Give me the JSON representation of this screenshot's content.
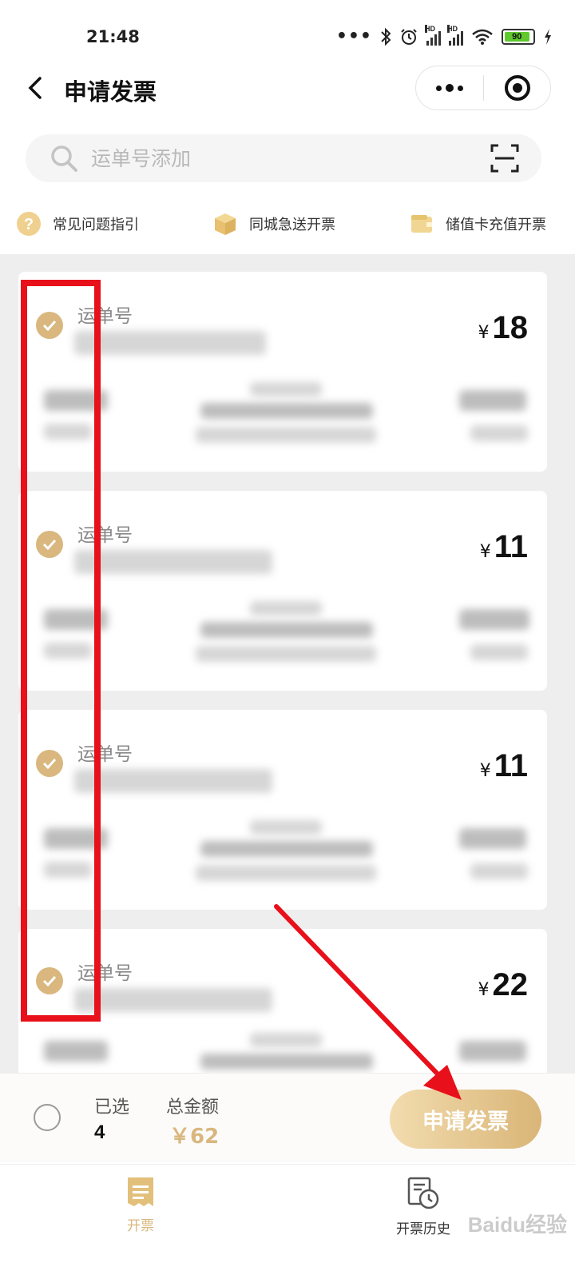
{
  "status_bar": {
    "time": "21:48",
    "dots": "•••",
    "hd1": "HD",
    "hd2": "HD",
    "battery": "90"
  },
  "header": {
    "title": "申请发票"
  },
  "search": {
    "placeholder": "运单号添加"
  },
  "quick_links": [
    {
      "label": "常见问题指引",
      "icon": "question-icon"
    },
    {
      "label": "同城急送开票",
      "icon": "box-icon"
    },
    {
      "label": "储值卡充值开票",
      "icon": "wallet-icon"
    }
  ],
  "orders": [
    {
      "label": "运单号",
      "currency": "¥",
      "amount": "18",
      "checked": true
    },
    {
      "label": "运单号",
      "currency": "¥",
      "amount": "11",
      "checked": true
    },
    {
      "label": "运单号",
      "currency": "¥",
      "amount": "11",
      "checked": true
    },
    {
      "label": "运单号",
      "currency": "¥",
      "amount": "22",
      "checked": true
    }
  ],
  "summary": {
    "selected_label": "已选",
    "selected_count": "4",
    "total_label": "总金额",
    "total_amount": "￥62",
    "apply_label": "申请发票"
  },
  "tabbar": {
    "tabs": [
      {
        "label": "开票",
        "active": true
      },
      {
        "label": "开票历史",
        "active": false
      }
    ]
  },
  "watermark": "Baidu经验",
  "colors": {
    "accent": "#d9b77e",
    "annotation": "#e8101a"
  }
}
